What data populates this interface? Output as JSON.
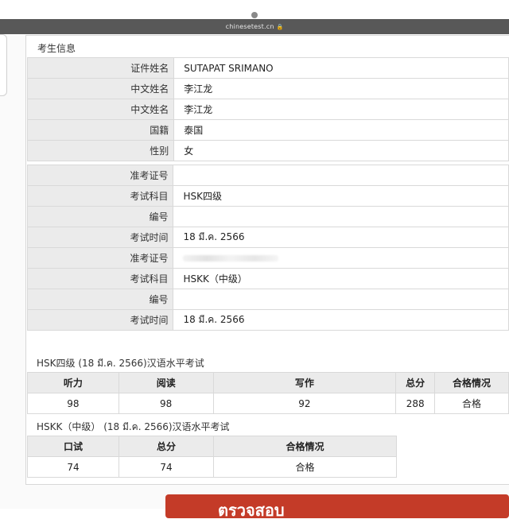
{
  "browser": {
    "url": "chinesetest.cn",
    "lock_glyph": "🔒"
  },
  "section_title": "考生信息",
  "personal": [
    {
      "label": "证件姓名",
      "value": "SUTAPAT SRIMANO"
    },
    {
      "label": "中文姓名",
      "value": "李江龙"
    },
    {
      "label": "中文姓名",
      "value": "李江龙"
    },
    {
      "label": "国籍",
      "value": "泰国"
    },
    {
      "label": "性别",
      "value": "女"
    }
  ],
  "exam": [
    {
      "label": "准考证号",
      "value": ""
    },
    {
      "label": "考试科目",
      "value": "HSK四级"
    },
    {
      "label": "编号",
      "value": ""
    },
    {
      "label": "考试时间",
      "value": "18 มี.ค. 2566"
    },
    {
      "label": "准考证号",
      "value": ""
    },
    {
      "label": "考试科目",
      "value": "HSKK（中级）"
    },
    {
      "label": "编号",
      "value": ""
    },
    {
      "label": "考试时间",
      "value": "18 มี.ค. 2566"
    }
  ],
  "hsk": {
    "title": "HSK四级 (18 มี.ค. 2566)汉语水平考试",
    "headers": [
      "听力",
      "阅读",
      "写作",
      "总分",
      "合格情况"
    ],
    "values": [
      "98",
      "98",
      "92",
      "288",
      "合格"
    ]
  },
  "hskk": {
    "title": "HSKK（中级） (18 มี.ค. 2566)汉语水平考试",
    "headers": [
      "口试",
      "总分",
      "合格情况"
    ],
    "values": [
      "74",
      "74",
      "合格"
    ]
  },
  "button": {
    "label": "ตรวจสอบ",
    "color": "#c43b28"
  }
}
